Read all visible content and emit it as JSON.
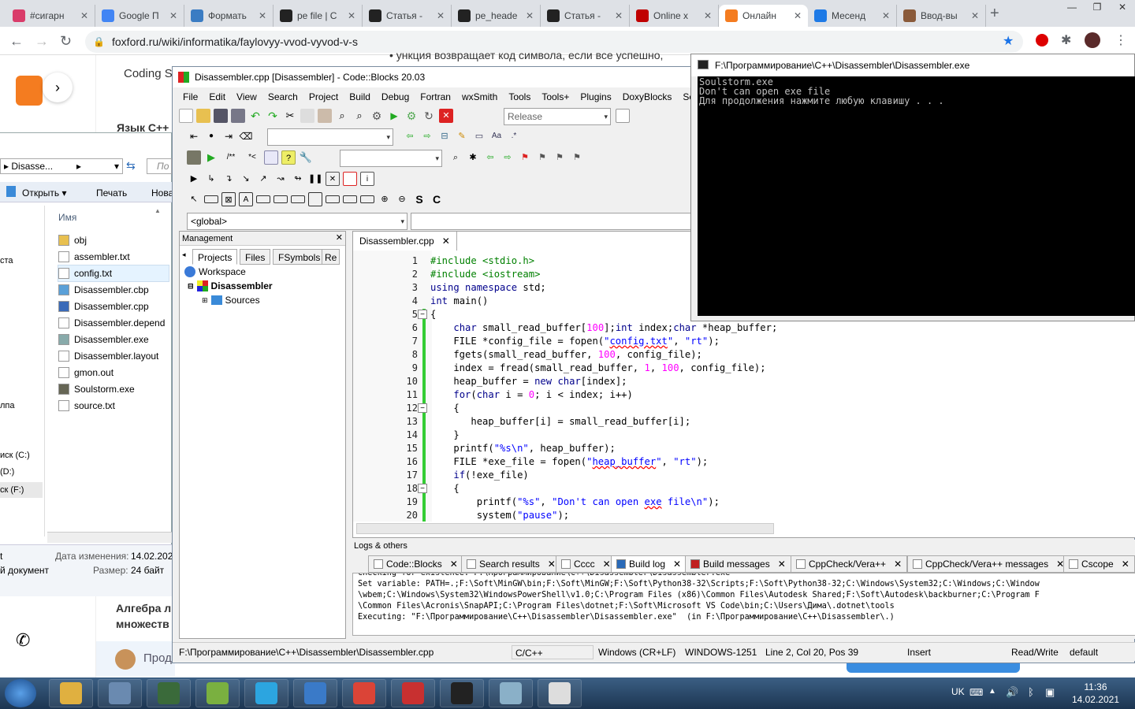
{
  "browser": {
    "tabs": [
      {
        "label": "#сигарн",
        "icon": "instagram-icon",
        "color": "#d93c6a"
      },
      {
        "label": "Google П",
        "icon": "google-icon",
        "color": "#4285f4"
      },
      {
        "label": "Формать",
        "icon": "docs-icon",
        "color": "#3a7cc3"
      },
      {
        "label": "pe file | С",
        "icon": "pe-icon",
        "color": "#222222"
      },
      {
        "label": "Статья -",
        "icon": "article-icon",
        "color": "#222222"
      },
      {
        "label": "pe_heade",
        "icon": "pe-icon",
        "color": "#222222"
      },
      {
        "label": "Статья -",
        "icon": "article-icon",
        "color": "#222222"
      },
      {
        "label": "Online x",
        "icon": "d-icon",
        "color": "#c00000"
      },
      {
        "label": "Онлайн",
        "icon": "foxford-icon",
        "color": "#f47c20"
      },
      {
        "label": "Месенд",
        "icon": "messenger-icon",
        "color": "#1e7ae6"
      },
      {
        "label": "Ввод-вы",
        "icon": "page-icon",
        "color": "#8a5a3a"
      }
    ],
    "url": "foxford.ru/wiki/informatika/faylovyy-vvod-vyvod-v-s"
  },
  "page": {
    "coding": "Coding S",
    "lang_cpp": "Язык C++",
    "algebra": "Алгебра л",
    "sets": "множеств",
    "cookie": "Прод",
    "partial_line": "• ункция возвращает код символа, если все успешно,"
  },
  "explorer": {
    "path": "Disasse...",
    "search": "По",
    "open": "Открыть",
    "print": "Печать",
    "new": "Нова",
    "col_name": "Имя",
    "files": [
      "obj",
      "assembler.txt",
      "config.txt",
      "Disassembler.cbp",
      "Disassembler.cpp",
      "Disassembler.depend",
      "Disassembler.exe",
      "Disassembler.layout",
      "gmon.out",
      "Soulstorm.exe",
      "source.txt"
    ],
    "left_labels": [
      "ста",
      "лпа",
      "иск (C:)",
      "(D:)",
      "ск (F:)"
    ],
    "details_modified_label": "Дата изменения:",
    "details_modified": "14.02.2021",
    "details_size_label": "Размер:",
    "details_size": "24 байт",
    "details_type": "й документ",
    "details_t": "t"
  },
  "codeblocks": {
    "title": "Disassembler.cpp [Disassembler] - Code::Blocks 20.03",
    "menu": [
      "File",
      "Edit",
      "View",
      "Search",
      "Project",
      "Build",
      "Debug",
      "Fortran",
      "wxSmith",
      "Tools",
      "Tools+",
      "Plugins",
      "DoxyBlocks",
      "Setti"
    ],
    "build_target": "Release",
    "scope": "<global>",
    "management": "Management",
    "mgmt_tabs": [
      "Projects",
      "Files",
      "FSymbols",
      "Re"
    ],
    "tree": {
      "workspace": "Workspace",
      "project": "Disassembler",
      "sources": "Sources"
    },
    "editor_tab": "Disassembler.cpp",
    "line_numbers": [
      "1",
      "2",
      "3",
      "4",
      "5",
      "6",
      "7",
      "8",
      "9",
      "10",
      "11",
      "12",
      "13",
      "14",
      "15",
      "16",
      "17",
      "18",
      "19",
      "20"
    ],
    "logs_title": "Logs & others",
    "log_tabs": [
      "Code::Blocks",
      "Search results",
      "Cccc",
      "Build log",
      "Build messages",
      "CppCheck/Vera++",
      "CppCheck/Vera++ messages",
      "Cscope"
    ],
    "log_lines": [
      "Checking for existence: F:\\Программирование\\C++\\Disassembler\\Disassembler.exe",
      "Set variable: PATH=.;F:\\Soft\\MinGW\\bin;F:\\Soft\\MinGW;F:\\Soft\\Python38-32\\Scripts;F:\\Soft\\Python38-32;C:\\Windows\\System32;C:\\Windows;C:\\Window",
      "\\wbem;C:\\Windows\\System32\\WindowsPowerShell\\v1.0;C:\\Program Files (x86)\\Common Files\\Autodesk Shared;F:\\Soft\\Autodesk\\backburner;C:\\Program F",
      "\\Common Files\\Acronis\\SnapAPI;C:\\Program Files\\dotnet;F:\\Soft\\Microsoft VS Code\\bin;C:\\Users\\Дима\\.dotnet\\tools",
      "Executing: \"F:\\Программирование\\C++\\Disassembler\\Disassembler.exe\"  (in F:\\Программирование\\C++\\Disassembler\\.)"
    ],
    "status": {
      "path": "F:\\Программирование\\C++\\Disassembler\\Disassembler.cpp",
      "lang": "C/C++",
      "eol": "Windows (CR+LF)",
      "encoding": "WINDOWS-1251",
      "position": "Line 2, Col 20, Pos 39",
      "mode": "Insert",
      "access": "Read/Write",
      "profile": "default"
    }
  },
  "console": {
    "title": "F:\\Программирование\\C++\\Disassembler\\Disassembler.exe",
    "lines": [
      "Soulstorm.exe",
      "Don't can open exe file",
      "Для продолжения нажмите любую клавишу . . ."
    ]
  },
  "taskbar": {
    "lang": "UK",
    "time": "11:36",
    "date": "14.02.2021",
    "apps": [
      {
        "name": "explorer-app",
        "color": "#e0b040"
      },
      {
        "name": "settings-app",
        "color": "#6a8ab0"
      },
      {
        "name": "terminal-app",
        "color": "#3a6a3a"
      },
      {
        "name": "notepadpp-app",
        "color": "#7ab040"
      },
      {
        "name": "telegram-app",
        "color": "#2ca5e0"
      },
      {
        "name": "qbittorrent-app",
        "color": "#3a7ac8"
      },
      {
        "name": "chrome-app",
        "color": "#db4437"
      },
      {
        "name": "codeblocks-app",
        "color": "#c83030"
      },
      {
        "name": "bug-app",
        "color": "#222222"
      },
      {
        "name": "notes-app",
        "color": "#8ab0c8"
      },
      {
        "name": "console-app",
        "color": "#dddddd"
      }
    ]
  }
}
